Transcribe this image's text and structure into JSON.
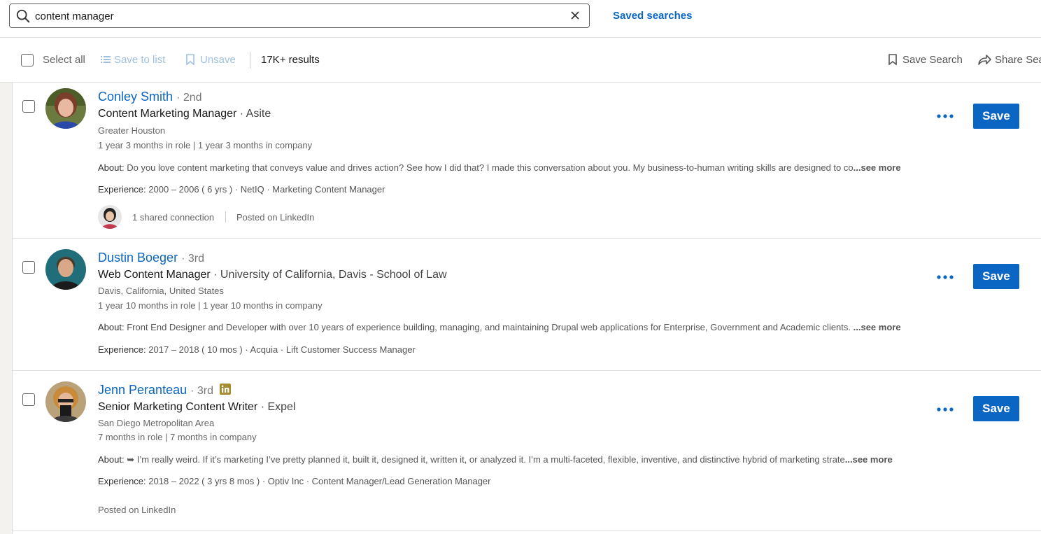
{
  "search": {
    "value": "content manager",
    "saved_searches_label": "Saved searches"
  },
  "toolbar": {
    "select_all": "Select all",
    "save_to_list": "Save to list",
    "unsave": "Unsave",
    "results": "17K+ results",
    "save_search": "Save Search",
    "share_search": "Share Search"
  },
  "results": [
    {
      "name": "Conley Smith",
      "degree": "· 2nd",
      "title": "Content Marketing Manager",
      "company": "· Asite",
      "location": "Greater Houston",
      "tenure": "1 year 3 months in role | 1 year 3 months in company",
      "about_label": "About:",
      "about": "Do you love content marketing that conveys value and drives action? See how I did that? I made this conversation about you. My business-to-human writing skills are designed to co",
      "see_more": "...see more",
      "experience_label": "Experience:",
      "experience": "2000 – 2006   ( 6 yrs ) · NetIQ · Marketing Content Manager",
      "shared_connection": "1 shared connection",
      "posted": "Posted on LinkedIn",
      "save_label": "Save"
    },
    {
      "name": "Dustin Boeger",
      "degree": "· 3rd",
      "title": "Web Content Manager",
      "company": "· University of California, Davis - School of Law",
      "location": "Davis, California, United States",
      "tenure": "1 year 10 months in role | 1 year 10 months in company",
      "about_label": "About:",
      "about": "Front End Designer and Developer with over 10 years of experience building, managing, and maintaining Drupal web applications for Enterprise, Government and Academic clients. ",
      "see_more": "...see more",
      "experience_label": "Experience:",
      "experience": "2017 – 2018   ( 10 mos ) · Acquia · Lift Customer Success Manager",
      "save_label": "Save"
    },
    {
      "name": "Jenn Peranteau",
      "degree": "· 3rd",
      "title": "Senior Marketing Content Writer",
      "company": "· Expel",
      "location": "San Diego Metropolitan Area",
      "tenure": "7 months in role | 7 months in company",
      "about_label": "About:",
      "about": "➥ I’m really weird. If it’s marketing I’ve pretty planned it, built it, designed it, written it, or analyzed it. I’m a multi-faceted, flexible, inventive, and distinctive hybrid of marketing strate",
      "see_more": "...see more",
      "experience_label": "Experience:",
      "experience": "2018 – 2022   ( 3 yrs 8 mos ) · Optiv Inc · Content Manager/Lead Generation Manager",
      "posted": "Posted on LinkedIn",
      "save_label": "Save"
    }
  ],
  "colors": {
    "link": "#0a66c2",
    "button": "#0a66c2",
    "disabled_link": "#9fbfe0"
  }
}
